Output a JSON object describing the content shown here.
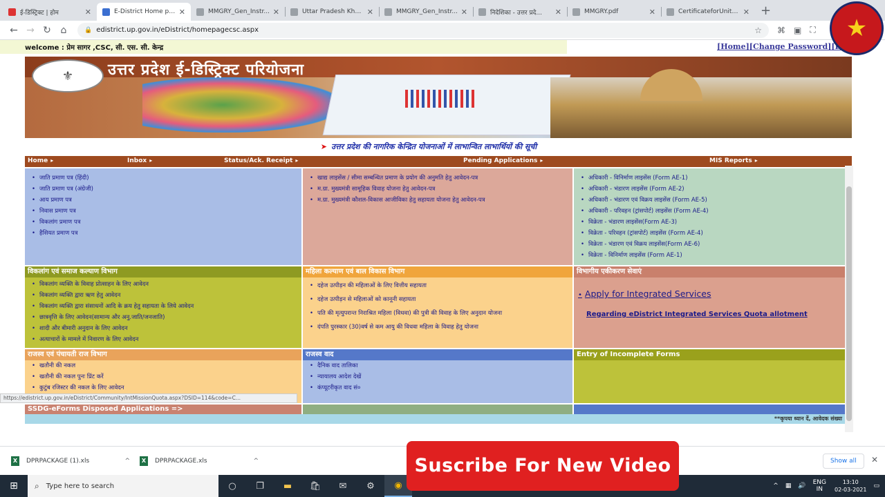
{
  "browser": {
    "tabs": [
      {
        "title": "ई-डिस्ट्रिक्ट | होम",
        "active": false
      },
      {
        "title": "E-District Home pa...",
        "active": true
      },
      {
        "title": "MMGRY_Gen_Instr...",
        "active": false
      },
      {
        "title": "Uttar Pradesh Khad...",
        "active": false
      },
      {
        "title": "MMGRY_Gen_Instr...",
        "active": false
      },
      {
        "title": "निदेशिका - उत्तर प्रदे...",
        "active": false
      },
      {
        "title": "MMGRY.pdf",
        "active": false
      },
      {
        "title": "CertificateforUnitL...",
        "active": false
      }
    ],
    "url": "edistrict.up.gov.in/eDistrict/homepagecsc.aspx",
    "status_url": "https://edistrict.up.gov.in/eDistrict/Community/IntMissionQuota.aspx?DSID=114&code=C..."
  },
  "page": {
    "welcome": "welcome : प्रेम सागर ,CSC, सी. एस. सी. केन्द्र",
    "top_links": [
      "[Home]",
      "[Change Password]",
      "[Lo"
    ],
    "banner_title": "उत्तर प्रदेश ई-डिस्ट्रिक्ट परियोजना",
    "subtitle": "उत्तर प्रदेश की नागरिक केन्द्रित योजनाओं में लाभान्वित लाभार्थियों की सूची",
    "menu": [
      "Home",
      "Inbox",
      "Status/Ack. Receipt",
      "Pending Applications",
      "MIS Reports"
    ],
    "col1_items": [
      "जाति प्रमाण पत्र (हिंदी)",
      "जाति प्रमाण पत्र (अंग्रेजी)",
      "आय प्रमाण पत्र",
      "निवास प्रमाण पत्र",
      "विकलांग प्रमाण पत्र",
      "हैसियत प्रमाण पत्र"
    ],
    "col2_items": [
      "खाद्य लाइसेंस / सीमा सम्बन्धित प्रमाण के प्रयोग की अनुमति हेतु आवेदन-पत्र",
      "म.ग्रा. मुख्यमंत्री सामूहिक विवाह योजना हेतु आवेदन-पत्र",
      "म.ग्रा. मुख्यमंत्री कौशल-विकास आजीविका हेतु सहायता योजना हेतु आवेदन-पत्र"
    ],
    "col3_items": [
      "अधिकारी - विनिर्माण लाइसेंस (Form AE-1)",
      "अधिकारी - भंडारण लाइसेंस (Form AE-2)",
      "अधिकारी - भंडारण एवं विक्रय लाइसेंस (Form AE-5)",
      "अधिकारी - परिवहन (ट्रांसपोर्ट) लाइसेंस (Form AE-4)",
      "विक्रेता - भंडारण लाइसेंस(Form AE-3)",
      "विक्रेता - परिवहन (ट्रांसपोर्ट) लाइसेंस (Form AE-4)",
      "विक्रेता - भंडारण एवं विक्रय लाइसेंस(Form AE-6)",
      "विक्रेता - विनिर्माण लाइसेंस (Form AE-1)"
    ],
    "sec_viklang": {
      "header": "विकलांग एवं समाज कल्याण विभाग",
      "items": [
        "विकलांग व्यक्ति के विवाह प्रोत्साहन के लिए आवेदन",
        "विकलांग व्यक्ति द्वारा ऋण हेतु आवेदन",
        "विकलांग व्यक्ति द्वारा संसाधनों आदि के क्रय हेतु सहायता के लिये आवेदन",
        "छात्रवृत्ति के लिए आवेदन(सामान्य और अनु.जाति/जनजाति)",
        "शादी और बीमारी अनुदान के लिए आवेदन",
        "अत्याचारों के मामले में निवारण के लिए आवेदन"
      ]
    },
    "sec_mahila": {
      "header": "महिला कल्याण एवं बाल विकास विभाग",
      "items": [
        "दहेज उत्पीड़न की महिलाओं के लिए वित्तीय सहायता",
        "दहेज उत्पीड़न से महिलाओं को कानूनी सहायता",
        "पति की मृत्युपरान्त निराश्रित महिला (विधवा) की पुत्री की विवाह के लिए अनुदान योजना",
        "दंपति पुरस्कार (30)वर्ष से कम आयु की विधवा महिला के विवाह हेतु योजना"
      ]
    },
    "sec_vibhagiya": {
      "header": "विभागीय एकीकरण सेवाएं",
      "apply": "Apply for Integrated Services",
      "quota": "Regarding eDistrict Integrated Services Quota allotment"
    },
    "sec_rajaswa": {
      "header": "राजस्व एवं पंचायती राज विभाग",
      "items": [
        "खतौनी की नकल",
        "खतौनी की नकल पुनः प्रिंट करें",
        "कुटुंब रजिस्टर की नकल के लिए आवेदन"
      ]
    },
    "sec_rajaswa_vad": {
      "header": "राजस्व वाद",
      "items": [
        "दैनिक वाद तालिका",
        "न्यायालय आदेश देखें",
        "कंप्यूटरीकृत वाद सं०"
      ]
    },
    "sec_incomplete": {
      "header": "Entry of Incomplete Forms"
    },
    "ssdg": "SSDG-eForms Disposed Applications  =>",
    "footer_note": "**कृपया ध्यान दें, आवेदक संख्या"
  },
  "downloads": [
    {
      "name": "DPRPACKAGE (1).xls"
    },
    {
      "name": "DPRPACKAGE.xls"
    }
  ],
  "show_all": "Show all",
  "overlay": {
    "subscribe": "Suscribe For New Video"
  },
  "taskbar": {
    "search_placeholder": "Type here to search",
    "lang": "ENG",
    "lang2": "IN",
    "time": "13:10",
    "date": "02-03-2021"
  },
  "colors": {
    "menu_brown": "#9e4a1f",
    "blue_cell": "#a9bde6",
    "pink_cell": "#dca89a",
    "green_cell": "#b9d7c1",
    "olive_cell": "#bdc23a",
    "orange_cell": "#fbd28c",
    "salmon_cell": "#dba08e",
    "subscribe_red": "#e02020"
  }
}
